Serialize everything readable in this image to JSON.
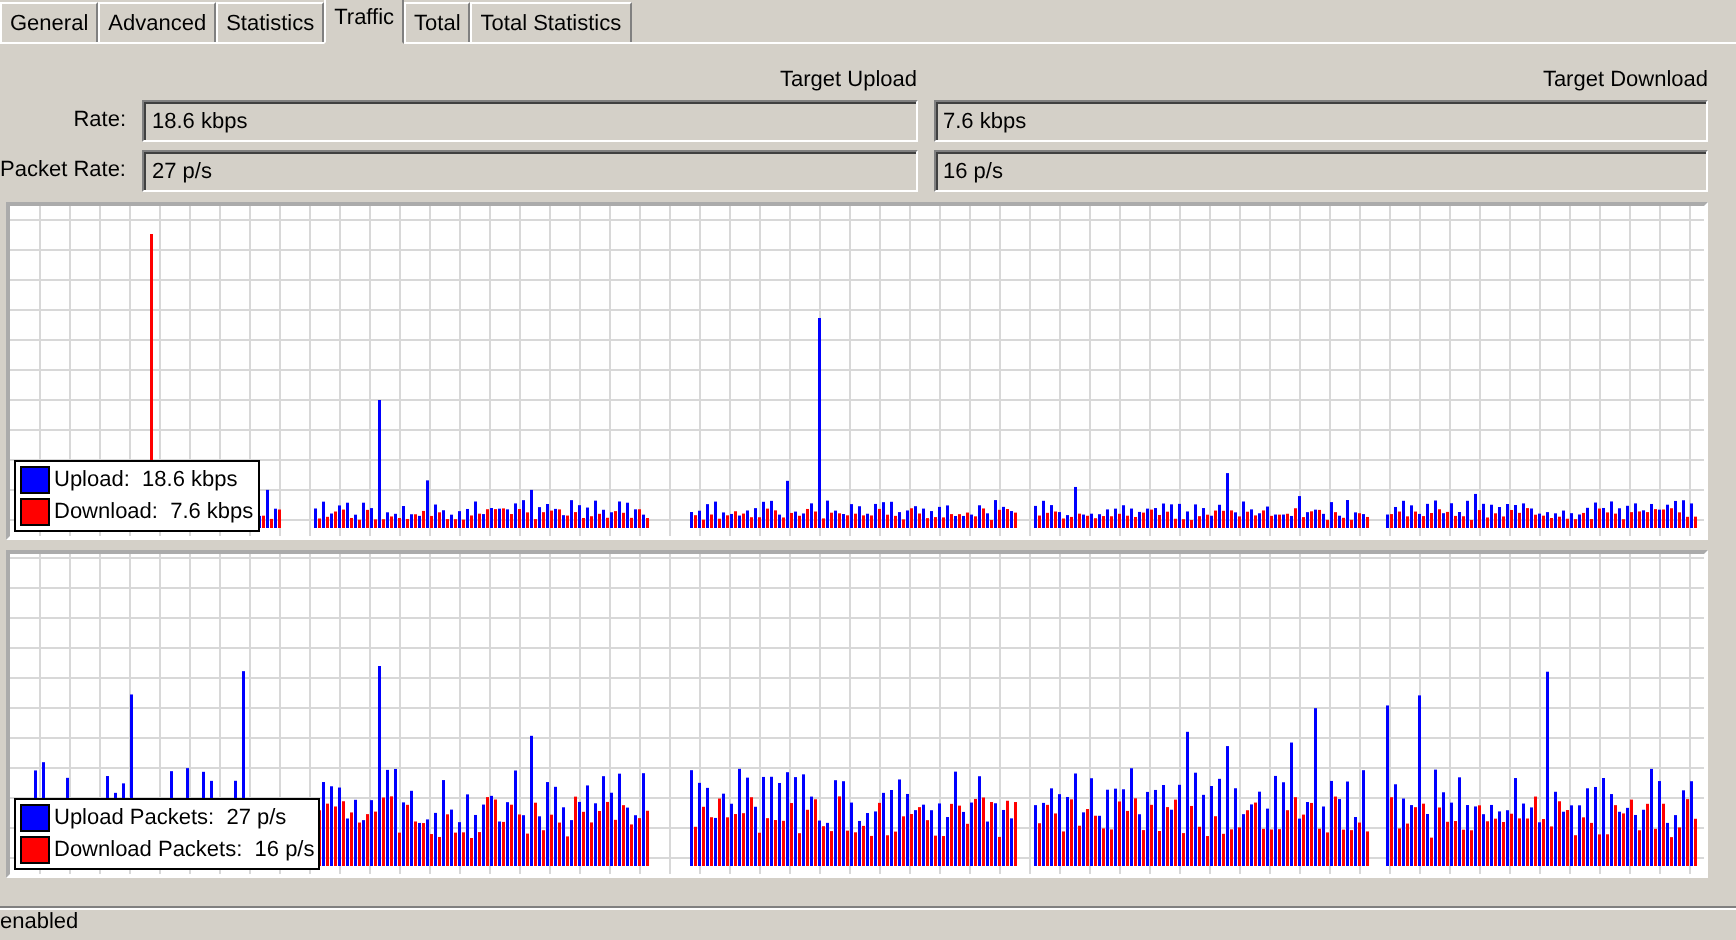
{
  "tabs": [
    {
      "label": "General",
      "selected": false
    },
    {
      "label": "Advanced",
      "selected": false
    },
    {
      "label": "Statistics",
      "selected": false
    },
    {
      "label": "Traffic",
      "selected": true
    },
    {
      "label": "Total",
      "selected": false
    },
    {
      "label": "Total Statistics",
      "selected": false
    }
  ],
  "headers": [
    "Target Upload",
    "Target Download"
  ],
  "fields": [
    {
      "label": "Rate:",
      "values": [
        "18.6 kbps",
        "7.6 kbps"
      ]
    },
    {
      "label": "Packet Rate:",
      "values": [
        "27 p/s",
        "16 p/s"
      ]
    }
  ],
  "graphs": [
    {
      "legend": [
        {
          "label": "Upload:  18.6 kbps",
          "color": "#0000ff"
        },
        {
          "label": "Download:  7.6 kbps",
          "color": "#ff0000"
        }
      ]
    },
    {
      "legend": [
        {
          "label": "Upload Packets:  27 p/s",
          "color": "#0000ff"
        },
        {
          "label": "Download Packets:  16 p/s",
          "color": "#ff0000"
        }
      ]
    }
  ],
  "status_bar": "enabled"
}
